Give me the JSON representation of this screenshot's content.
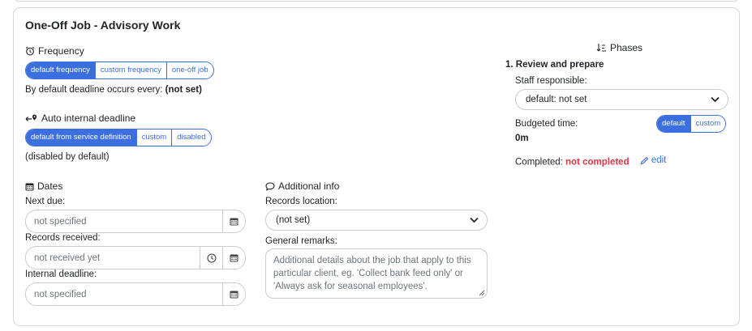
{
  "card": {
    "title": "One-Off Job - Advisory Work"
  },
  "frequency": {
    "label": "Frequency",
    "options": [
      "default frequency",
      "custom frequency",
      "one-off job"
    ],
    "active_index": 0,
    "default_prefix": "By default deadline occurs every:",
    "default_value": "(not set)"
  },
  "auto_deadline": {
    "label": "Auto internal deadline",
    "options": [
      "default from service definition",
      "custom",
      "disabled"
    ],
    "active_index": 0,
    "note": "(disabled by default)"
  },
  "dates": {
    "label": "Dates",
    "next_due": {
      "label": "Next due:",
      "placeholder": "not specified"
    },
    "records_received": {
      "label": "Records received:",
      "placeholder": "not received yet"
    },
    "internal_deadline": {
      "label": "Internal deadline:",
      "placeholder": "not specified"
    }
  },
  "additional_info": {
    "label": "Additional info",
    "records_location": {
      "label": "Records location:",
      "value": "(not set)"
    },
    "general_remarks": {
      "label": "General remarks:",
      "placeholder": "Additional details about the job that apply to this particular client, eg. 'Collect bank feed only' or 'Always ask for seasonal employees'."
    }
  },
  "phases": {
    "label": "Phases",
    "phase_title": "1. Review and prepare",
    "staff": {
      "label": "Staff responsible:",
      "value": "default: not set"
    },
    "budget": {
      "label": "Budgeted time:",
      "options": [
        "default",
        "custom"
      ],
      "active_index": 0,
      "value": "0m"
    },
    "completed": {
      "label": "Completed:",
      "status": "not completed",
      "edit_label": "edit"
    }
  },
  "colors": {
    "accent": "#3b6fe0",
    "danger": "#dc3545",
    "border": "#c9ccd0"
  }
}
